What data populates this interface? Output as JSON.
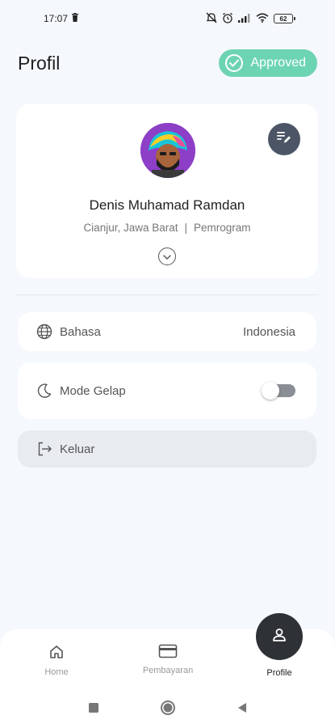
{
  "status_bar": {
    "time": "17:07",
    "battery": "62"
  },
  "header": {
    "title": "Profil",
    "badge_label": "Approved"
  },
  "profile": {
    "name": "Denis Muhamad Ramdan",
    "location": "Cianjur, Jawa Barat",
    "separator": "|",
    "occupation": "Pemrogram"
  },
  "settings": {
    "language_label": "Bahasa",
    "language_value": "Indonesia",
    "dark_mode_label": "Mode Gelap",
    "dark_mode_on": false,
    "logout_label": "Keluar"
  },
  "bottom_nav": {
    "home_label": "Home",
    "payment_label": "Pembayaran",
    "profile_label": "Profile",
    "active": "Profile"
  },
  "colors": {
    "accent_approved": "#6dd4b3",
    "edit_button": "#4c5566",
    "fab": "#2e3135",
    "background": "#f5f8fc"
  },
  "icons": [
    "trash-icon",
    "mute-icon",
    "alarm-icon",
    "signal-icon",
    "wifi-icon",
    "battery-icon",
    "check-circle-icon",
    "edit-note-icon",
    "chevron-down-icon",
    "globe-icon",
    "moon-icon",
    "logout-icon",
    "home-icon",
    "card-icon",
    "person-icon"
  ]
}
